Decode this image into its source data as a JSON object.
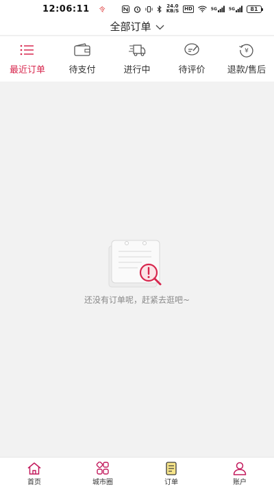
{
  "status_bar": {
    "time": "12:06:11",
    "notif_dot": "令",
    "hd_label": "HD",
    "speed_value": "24.0",
    "speed_unit": "KB/S",
    "signal1": "5G",
    "signal2": "5G",
    "battery": "81"
  },
  "header": {
    "title": "全部订单"
  },
  "tabs": [
    {
      "label": "最近订单",
      "icon": "list-icon",
      "active": true
    },
    {
      "label": "待支付",
      "icon": "wallet-icon",
      "active": false
    },
    {
      "label": "进行中",
      "icon": "truck-icon",
      "active": false
    },
    {
      "label": "待评价",
      "icon": "comment-icon",
      "active": false
    },
    {
      "label": "退款/售后",
      "icon": "refund-icon",
      "active": false
    }
  ],
  "empty_state": {
    "message": "还没有订单呢，赶紧去逛吧~"
  },
  "bottom_nav": [
    {
      "label": "首页",
      "icon": "home-icon"
    },
    {
      "label": "城市圈",
      "icon": "grid-icon"
    },
    {
      "label": "订单",
      "icon": "order-icon"
    },
    {
      "label": "账户",
      "icon": "account-icon"
    }
  ],
  "colors": {
    "accent": "#d7264d",
    "background": "#f2f2f2"
  }
}
